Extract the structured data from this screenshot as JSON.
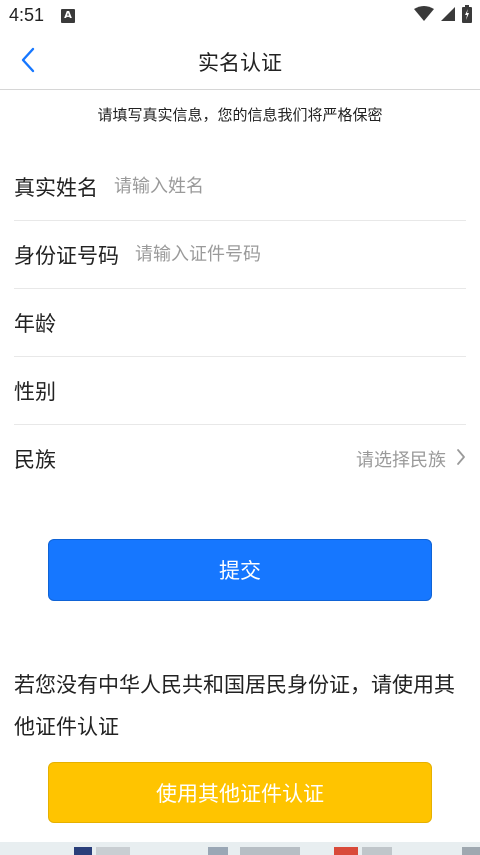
{
  "status_bar": {
    "time": "4:51",
    "notification_icon_letter": "A",
    "icons": [
      "wifi-icon",
      "signal-icon",
      "battery-icon"
    ]
  },
  "nav": {
    "title": "实名认证",
    "back_icon": "chevron-left-icon",
    "accent_color": "#1677ff"
  },
  "notice": "请填写真实信息，您的信息我们将严格保密",
  "form": {
    "name": {
      "label": "真实姓名",
      "value": "",
      "placeholder": "请输入姓名"
    },
    "id_number": {
      "label": "身份证号码",
      "value": "",
      "placeholder": "请输入证件号码"
    },
    "age": {
      "label": "年龄",
      "value": ""
    },
    "gender": {
      "label": "性别",
      "value": ""
    },
    "ethnicity": {
      "label": "民族",
      "placeholder": "请选择民族",
      "icon": "chevron-right-icon"
    }
  },
  "submit": {
    "label": "提交",
    "color": "#1677ff"
  },
  "other_doc": {
    "text": "若您没有中华人民共和国居民身份证，请使用其他证件认证",
    "button_label": "使用其他证件认证",
    "button_color": "#ffc400"
  }
}
